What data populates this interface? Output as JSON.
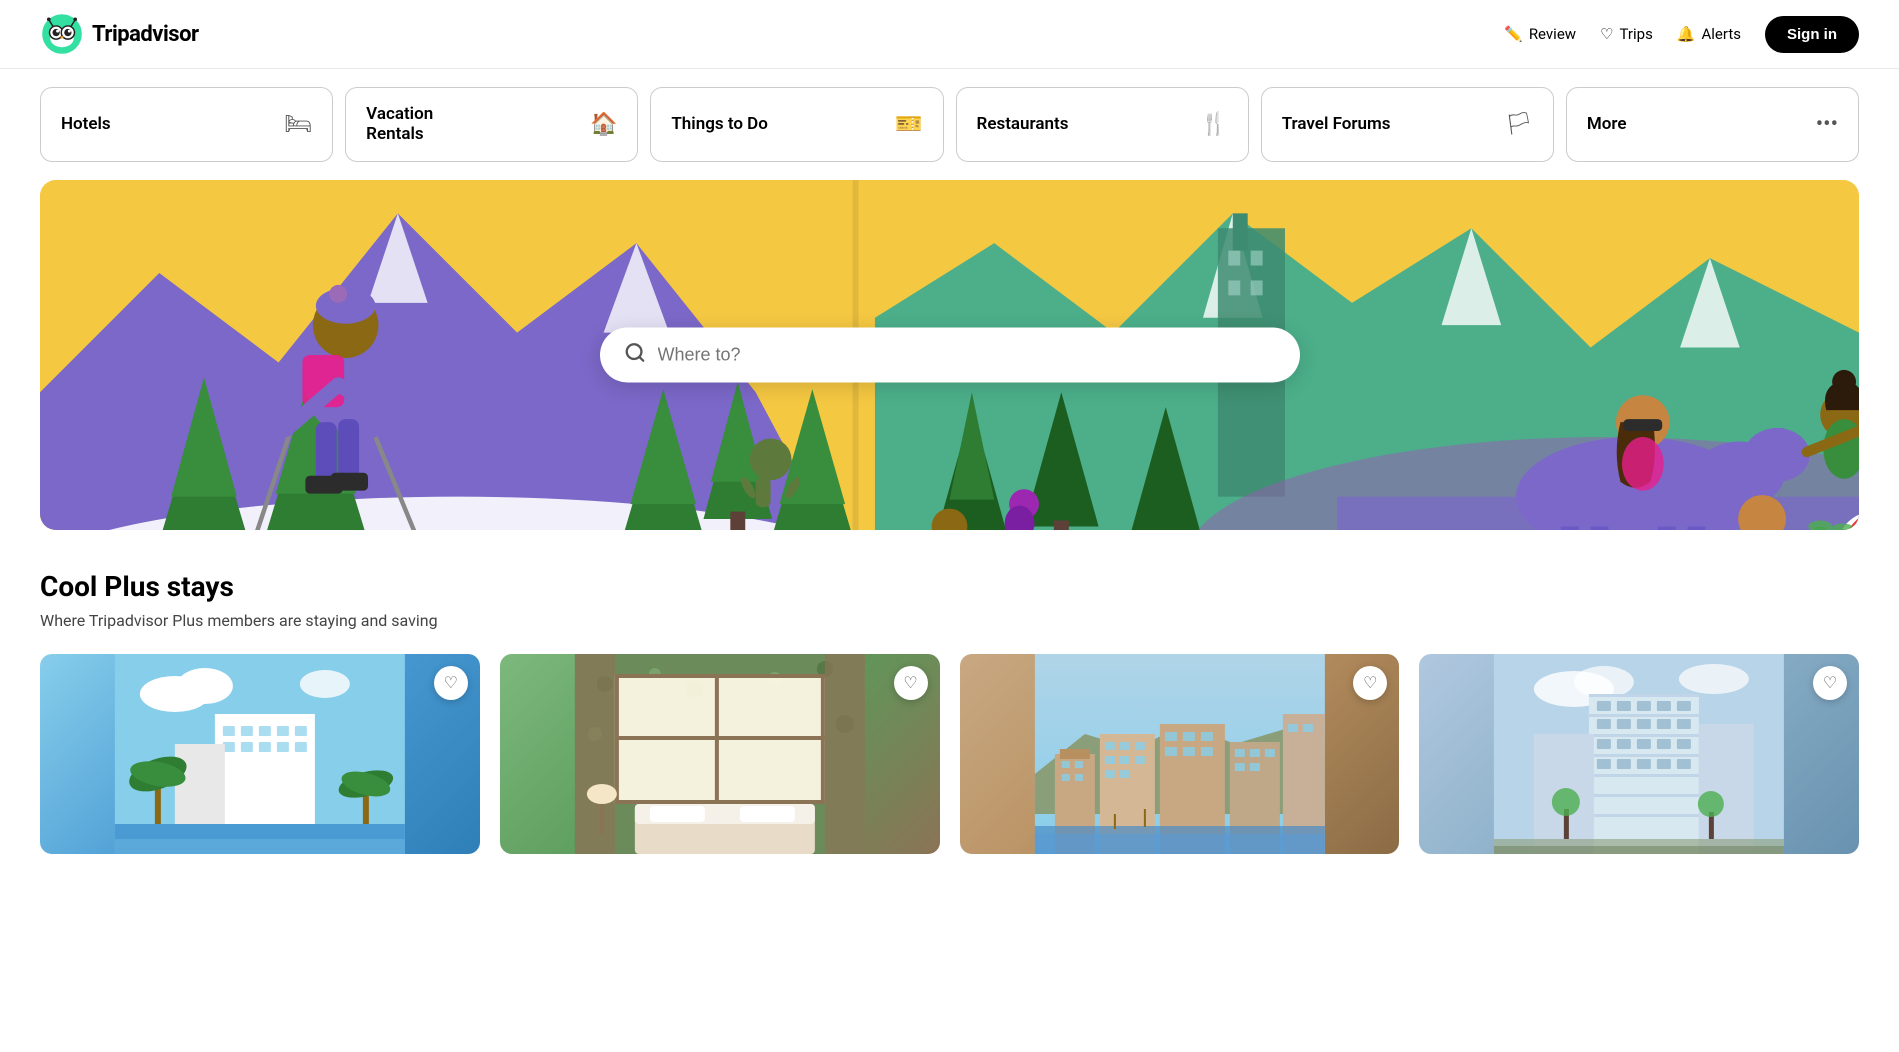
{
  "header": {
    "logo_text": "Tripadvisor",
    "actions": [
      {
        "id": "review",
        "label": "Review",
        "icon": "✏️"
      },
      {
        "id": "trips",
        "label": "Trips",
        "icon": "♡"
      },
      {
        "id": "alerts",
        "label": "Alerts",
        "icon": "🔔"
      }
    ],
    "sign_in_label": "Sign in"
  },
  "nav": {
    "tabs": [
      {
        "id": "hotels",
        "label": "Hotels",
        "icon": "🛏"
      },
      {
        "id": "vacation-rentals",
        "label": "Vacation\nRentals",
        "icon": "🏠"
      },
      {
        "id": "things-to-do",
        "label": "Things to Do",
        "icon": "🎫"
      },
      {
        "id": "restaurants",
        "label": "Restaurants",
        "icon": "🍴"
      },
      {
        "id": "travel-forums",
        "label": "Travel Forums",
        "icon": "🏳"
      },
      {
        "id": "more",
        "label": "More",
        "icon": "···"
      }
    ]
  },
  "hero": {
    "search_placeholder": "Where to?"
  },
  "cool_plus": {
    "title": "Cool Plus stays",
    "subtitle": "Where Tripadvisor Plus members are staying and saving",
    "cards": [
      {
        "id": "card-1",
        "alt": "Modern hotel with palm trees"
      },
      {
        "id": "card-2",
        "alt": "Interior hotel room with green floral wallpaper"
      },
      {
        "id": "card-3",
        "alt": "Coastal city buildings"
      },
      {
        "id": "card-4",
        "alt": "Hotel building exterior"
      }
    ]
  }
}
